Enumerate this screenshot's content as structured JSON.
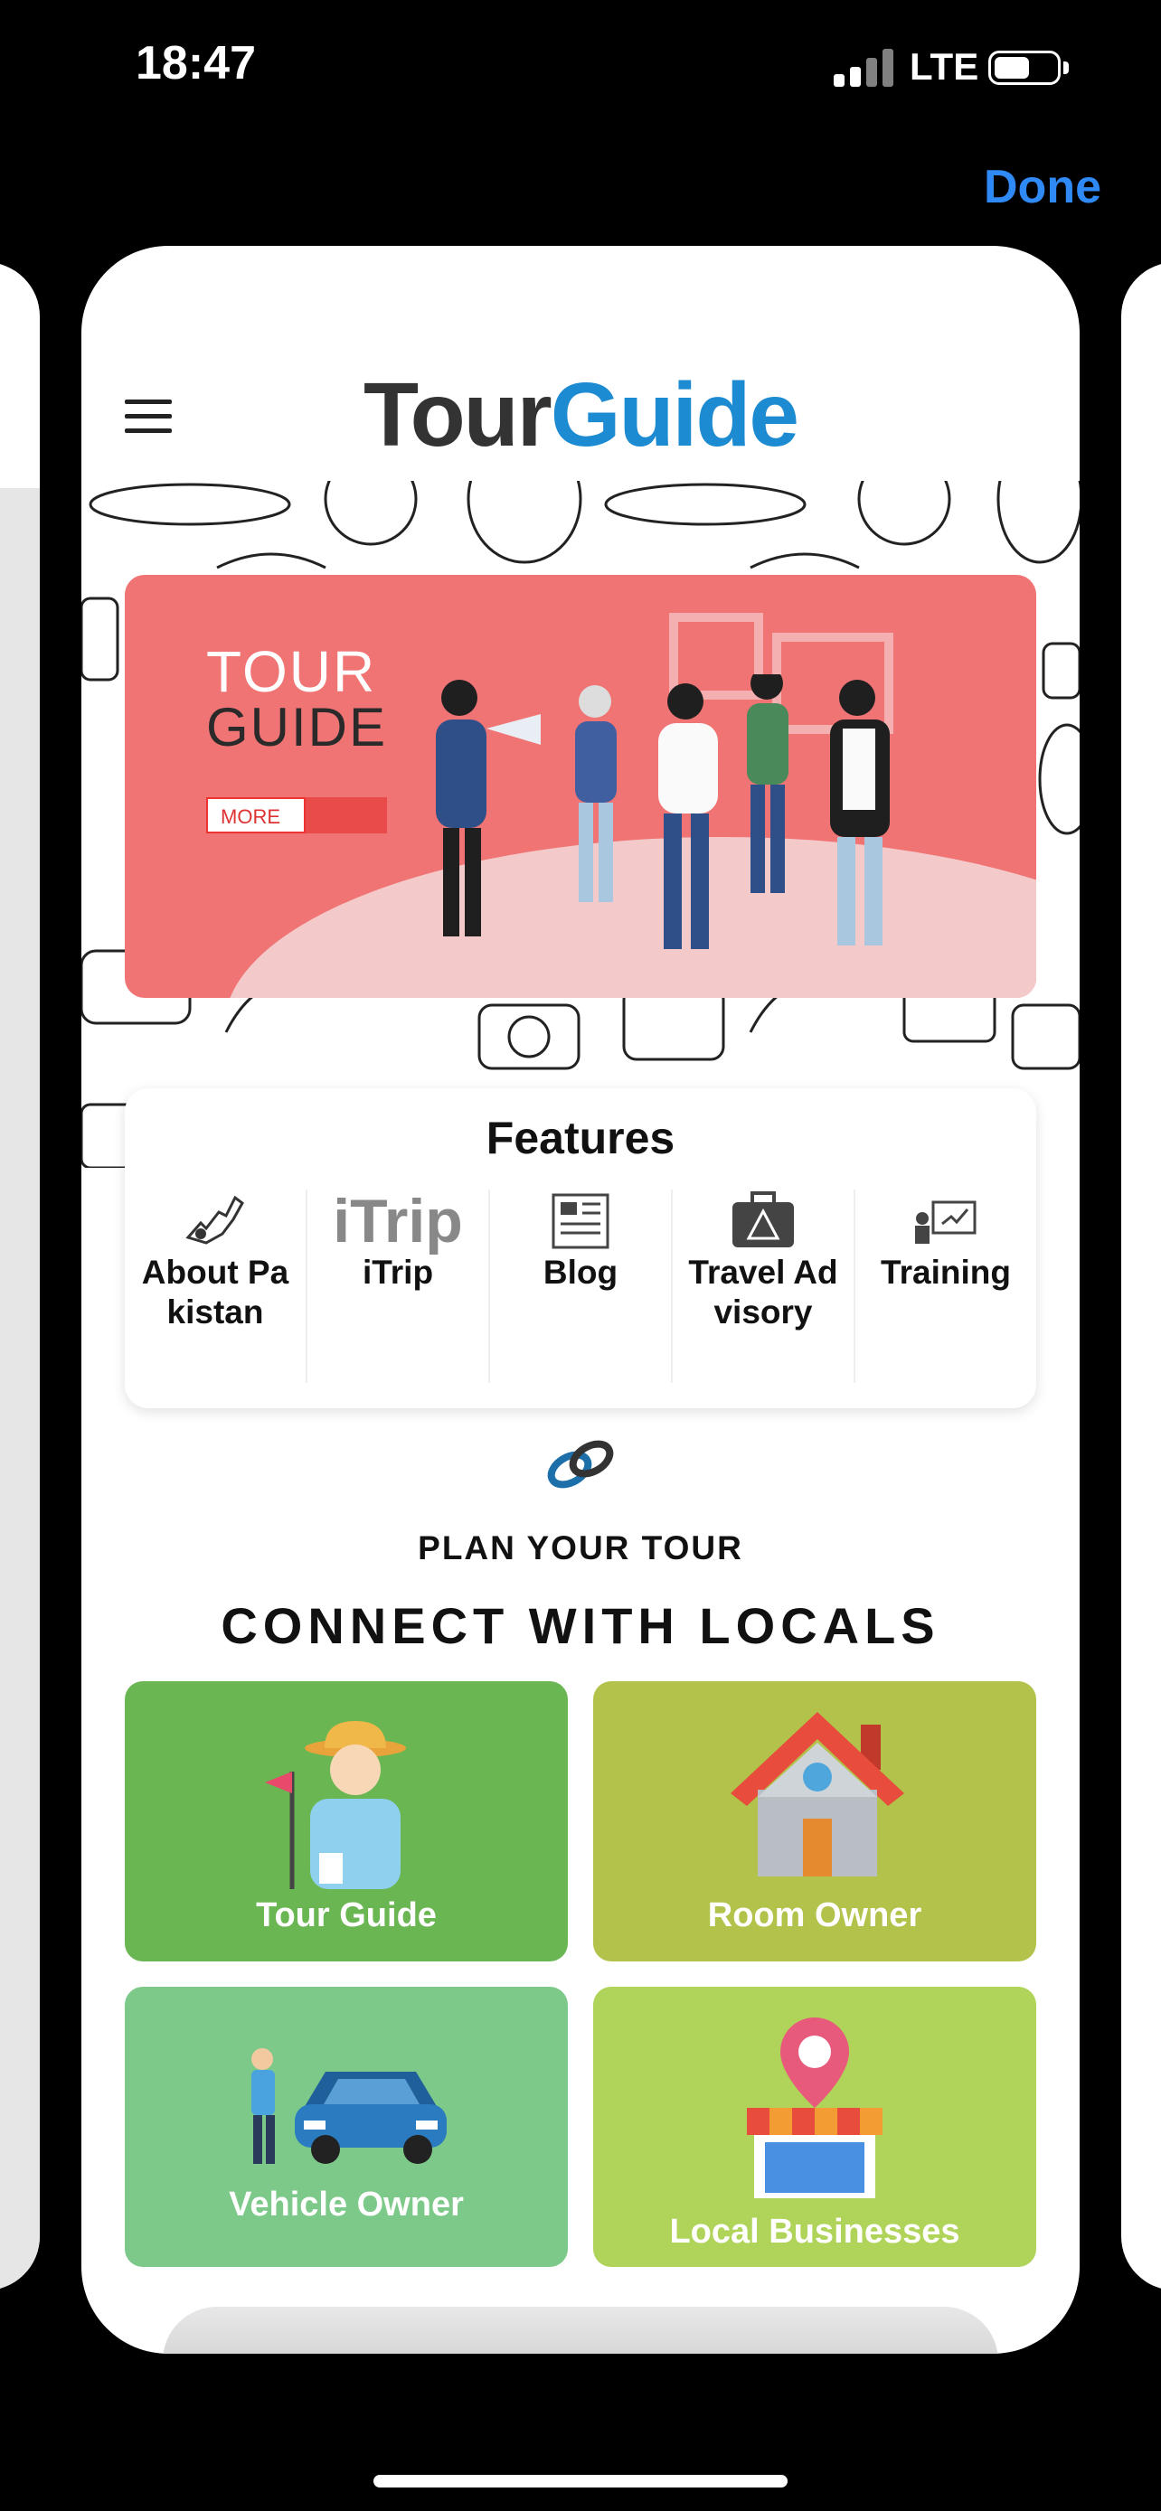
{
  "status": {
    "time": "18:47",
    "network": "LTE",
    "battery_percent": 45
  },
  "done_label": "Done",
  "app": {
    "logo_part1": "Tour",
    "logo_part2": "Guide",
    "colors": {
      "logo_dark": "#333333",
      "logo_blue": "#1c8bd1",
      "banner": "#f07474"
    }
  },
  "banner": {
    "title_line1": "TOUR",
    "title_line2": "GUIDE",
    "button": "MORE"
  },
  "features": {
    "heading": "Features",
    "items": [
      {
        "icon": "pakistan-map-icon",
        "label": "About Pakistan"
      },
      {
        "icon": "itrip-logo",
        "logo_text": "iTrip",
        "label": "iTrip"
      },
      {
        "icon": "newspaper-icon",
        "label": "Blog"
      },
      {
        "icon": "suitcase-warning-icon",
        "label": "Travel Advisory"
      },
      {
        "icon": "presentation-board-icon",
        "label": "Training"
      }
    ]
  },
  "plan": {
    "kicker": "PLAN YOUR TOUR",
    "heading": "CONNECT WITH LOCALS"
  },
  "tiles": [
    {
      "label": "Tour Guide",
      "color": "#6ab653",
      "icon": "tour-guide-icon"
    },
    {
      "label": "Room Owner",
      "color": "#b2c24a",
      "icon": "house-icon"
    },
    {
      "label": "Vehicle Owner",
      "color": "#7dc98a",
      "icon": "car-icon"
    },
    {
      "label": "Local Businesses",
      "color": "#b0d359",
      "icon": "shop-location-icon"
    }
  ]
}
